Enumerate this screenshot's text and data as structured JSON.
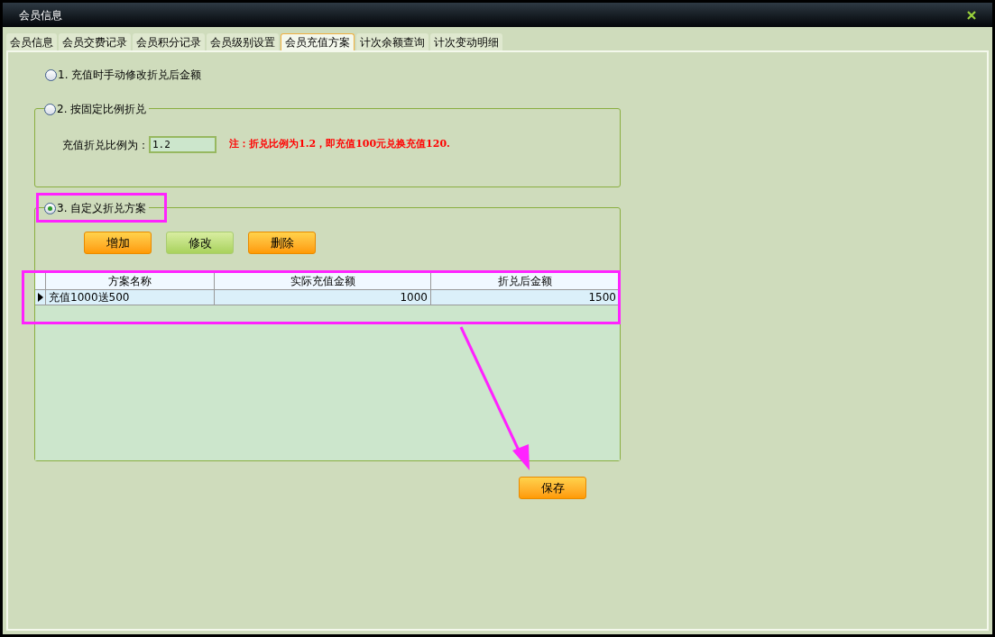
{
  "window": {
    "title": "会员信息"
  },
  "tabs": [
    {
      "label": "会员信息",
      "selected": false
    },
    {
      "label": "会员交费记录",
      "selected": false
    },
    {
      "label": "会员积分记录",
      "selected": false
    },
    {
      "label": "会员级别设置",
      "selected": false
    },
    {
      "label": "会员充值方案",
      "selected": true
    },
    {
      "label": "计次余额查询",
      "selected": false
    },
    {
      "label": "计次变动明细",
      "selected": false
    }
  ],
  "option_manual": {
    "label": "1. 充值时手动修改折兑后金额",
    "selected": false
  },
  "option_fixed": {
    "label": "2. 按固定比例折兑",
    "selected": false,
    "field_label": "充值折兑比例为：",
    "field_value": "1.2",
    "note": "注：折兑比例为1.2，即充值100元兑换充值120."
  },
  "option_custom": {
    "label": "3. 自定义折兑方案",
    "selected": true,
    "buttons": [
      {
        "label": "增加",
        "kind": "orange"
      },
      {
        "label": "修改",
        "kind": "green"
      },
      {
        "label": "删除",
        "kind": "orange"
      }
    ],
    "table": {
      "columns": [
        "方案名称",
        "实际充值金额",
        "折兑后金额"
      ],
      "rows": [
        {
          "cells": [
            "充值1000送500",
            "1000",
            "1500"
          ],
          "selected": true
        }
      ]
    }
  },
  "save_button": "保存"
}
